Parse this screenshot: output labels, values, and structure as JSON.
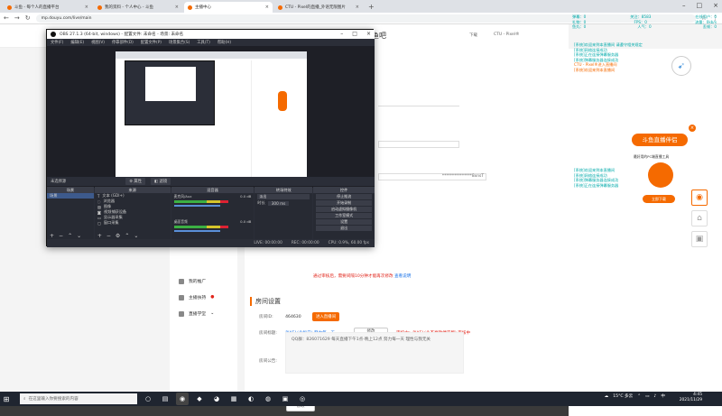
{
  "browser": {
    "tabs": [
      {
        "label": "斗鱼 - 每个人的直播平台",
        "active": false
      },
      {
        "label": "我的资料 - 个人中心 - 斗鱼",
        "active": false
      },
      {
        "label": "主播中心",
        "active": true
      },
      {
        "label": "CTU - Pixel的直播_外语无限图片",
        "active": false
      }
    ],
    "url": "mp.douyu.com/live/main"
  },
  "site": {
    "brand": "鱼吧",
    "download": "下载",
    "user": "CTU - Pixel®"
  },
  "sidebar": {
    "items": [
      "我的推广",
      "主播扶持",
      "直播学堂"
    ]
  },
  "main": {
    "warn_top": "通过审核后，需要间隔10分钟才能再次修改",
    "warn_top_link": "查看说明",
    "key_tail": "***************8xnsT",
    "room_section_title": "房间设置",
    "room_id_label": "房间ID:",
    "room_id": "464630",
    "room_id_btn": "进入直播间",
    "room_title_label": "房间标题:",
    "room_title": "PIXEL(永恒日) 努力每一天",
    "edit_btn": "修改",
    "title_warn": "审核中：PIXEL(永不衰微便宜版) 审核中",
    "title_warn2": "房间标题通过审核后，需要间隔10分钟才能再次修改",
    "notice_label": "房间公告:",
    "notice_text": "QQ群：826071629 每天直播下午1点-晚上12点 努力每一天 理性与我无关",
    "notice_btn": "修改"
  },
  "right": {
    "stats": [
      [
        "弹幕：0",
        "关注：8583",
        "在线用户：0"
      ],
      [
        "礼物：0",
        "FPS：0",
        "流量：0kb/s"
      ],
      [
        "鱼丸：0",
        "人气：0",
        "丢帧：0"
      ]
    ],
    "chat_top": [
      "[系统]欢迎来到本直播间 请遵守相关规定",
      "[系统]网络连接成功",
      "[系统]正在连接弹幕服务器",
      "[系统]弹幕服务器连接成功",
      "CTU - Pixel®进入直播间",
      "[系统]欢迎来到本直播间"
    ],
    "chat_bottom": [
      "[系统]欢迎来到本直播间",
      "[系统]网络连接成功",
      "[系统]弹幕服务器连接成功",
      "[系统]正在连接弹幕服务器"
    ],
    "promo_title": "斗鱼直播伴侣",
    "promo_sub": "最好用的PC端直播工具",
    "promo_btn": "立即下载"
  },
  "obs": {
    "title": "OBS 27.1.3 (64-bit, windows) - 配置文件: 未命名 - 场景: 未命名",
    "menu": [
      "文件(F)",
      "编辑(E)",
      "视图(V)",
      "停靠部件(D)",
      "配置文件(P)",
      "场景集合(S)",
      "工具(T)",
      "帮助(H)"
    ],
    "sub_label": "未选择源",
    "sub_btns": [
      "属性",
      "滤镜"
    ],
    "dock_titles": [
      "场景",
      "来源",
      "混音器",
      "转场特效",
      "控件"
    ],
    "scene": "场景",
    "sources": [
      "文本 (GDI+)",
      "浏览器",
      "图像",
      "视频捕获设备",
      "显示器采集",
      "窗口采集"
    ],
    "mixer": [
      {
        "name": "麦克风/Aux",
        "db": "0.0 dB"
      },
      {
        "name": "桌面音频",
        "db": "0.0 dB"
      }
    ],
    "transition": "淡出",
    "duration_label": "时长",
    "duration": "300 ms",
    "controls": [
      "停止推流",
      "开始录制",
      "启动虚拟摄像机",
      "工作室模式",
      "设置",
      "退出"
    ],
    "status": [
      "LIVE: 00:00:00",
      "REC: 00:00:00",
      "CPU: 0.9%, 60.00 fps"
    ]
  },
  "taskbar": {
    "search": "在这里输入你要搜索的内容",
    "weather": "15°C 多云",
    "time": "4:45",
    "date": "2021/11/29"
  }
}
